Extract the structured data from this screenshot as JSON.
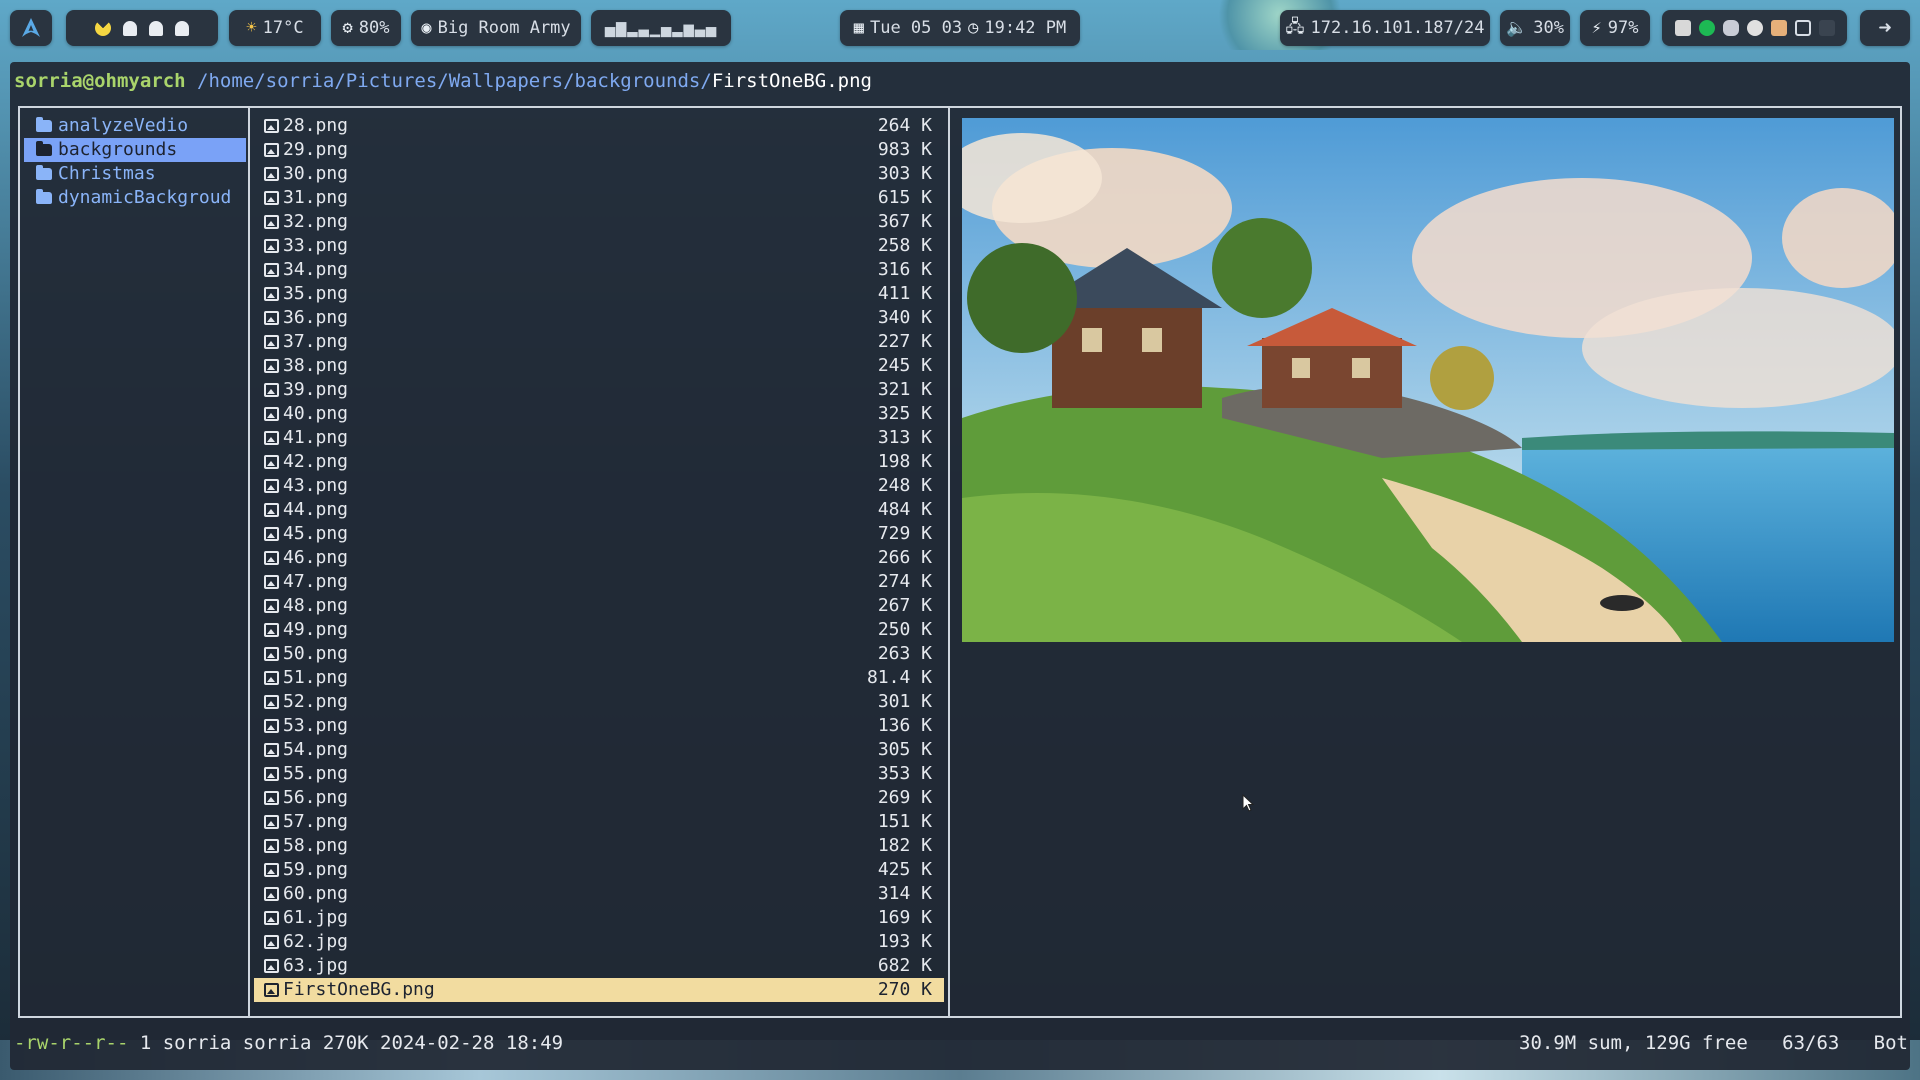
{
  "topbar": {
    "weather": "17°C",
    "cpu": "80%",
    "music": "Big Room Army",
    "visualizer": "▄▆▂▃▁▄▂▅▃▄",
    "date": "Tue 05 03",
    "time": "19:42 PM",
    "ip": "172.16.101.187/24",
    "volume": "30%",
    "battery": "97%"
  },
  "terminal": {
    "user": "sorria@ohmyarch",
    "path_dir": "/home/sorria/Pictures/Wallpapers/backgrounds/",
    "path_file": "FirstOneBG.png"
  },
  "folders": [
    {
      "name": "analyzeVedio"
    },
    {
      "name": "backgrounds"
    },
    {
      "name": "Christmas"
    },
    {
      "name": "dynamicBackgroud"
    }
  ],
  "files": [
    {
      "name": "28.png",
      "size": "264 K"
    },
    {
      "name": "29.png",
      "size": "983 K"
    },
    {
      "name": "30.png",
      "size": "303 K"
    },
    {
      "name": "31.png",
      "size": "615 K"
    },
    {
      "name": "32.png",
      "size": "367 K"
    },
    {
      "name": "33.png",
      "size": "258 K"
    },
    {
      "name": "34.png",
      "size": "316 K"
    },
    {
      "name": "35.png",
      "size": "411 K"
    },
    {
      "name": "36.png",
      "size": "340 K"
    },
    {
      "name": "37.png",
      "size": "227 K"
    },
    {
      "name": "38.png",
      "size": "245 K"
    },
    {
      "name": "39.png",
      "size": "321 K"
    },
    {
      "name": "40.png",
      "size": "325 K"
    },
    {
      "name": "41.png",
      "size": "313 K"
    },
    {
      "name": "42.png",
      "size": "198 K"
    },
    {
      "name": "43.png",
      "size": "248 K"
    },
    {
      "name": "44.png",
      "size": "484 K"
    },
    {
      "name": "45.png",
      "size": "729 K"
    },
    {
      "name": "46.png",
      "size": "266 K"
    },
    {
      "name": "47.png",
      "size": "274 K"
    },
    {
      "name": "48.png",
      "size": "267 K"
    },
    {
      "name": "49.png",
      "size": "250 K"
    },
    {
      "name": "50.png",
      "size": "263 K"
    },
    {
      "name": "51.png",
      "size": "81.4 K"
    },
    {
      "name": "52.png",
      "size": "301 K"
    },
    {
      "name": "53.png",
      "size": "136 K"
    },
    {
      "name": "54.png",
      "size": "305 K"
    },
    {
      "name": "55.png",
      "size": "353 K"
    },
    {
      "name": "56.png",
      "size": "269 K"
    },
    {
      "name": "57.png",
      "size": "151 K"
    },
    {
      "name": "58.png",
      "size": "182 K"
    },
    {
      "name": "59.png",
      "size": "425 K"
    },
    {
      "name": "60.png",
      "size": "314 K"
    },
    {
      "name": "61.jpg",
      "size": "169 K"
    },
    {
      "name": "62.jpg",
      "size": "193 K"
    },
    {
      "name": "63.jpg",
      "size": "682 K"
    },
    {
      "name": "FirstOneBG.png",
      "size": "270 K"
    }
  ],
  "status": {
    "perm": "-rw-r--r--",
    "info": " 1 sorria sorria 270K 2024-02-28 18:49",
    "summary": "30.9M sum, 129G free",
    "position": "63/63",
    "scroll": "Bot"
  }
}
